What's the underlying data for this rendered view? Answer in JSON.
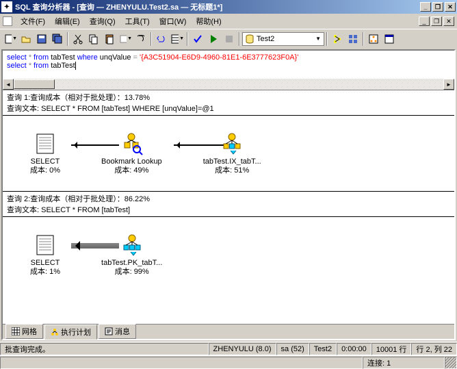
{
  "title": "SQL 查询分析器 - [查询 — ZHENYULU.Test2.sa — 无标题1*]",
  "menu": {
    "file": "文件(F)",
    "edit": "编辑(E)",
    "query": "查询(Q)",
    "tools": "工具(T)",
    "window": "窗口(W)",
    "help": "帮助(H)"
  },
  "toolbar": {
    "db_selected": "Test2"
  },
  "sql": {
    "line1_select": "select",
    "line1_star": "*",
    "line1_from": "from",
    "line1_tab": "tabTest",
    "line1_where": "where",
    "line1_col": "unqValue",
    "line1_eq": "=",
    "line1_str": "'{A3C51904-E6D9-4960-81E1-6E3777623F0A}'",
    "line2_select": "select",
    "line2_star": "*",
    "line2_from": "from",
    "line2_tab": "tabTest"
  },
  "plan": {
    "q1": {
      "header": "查询 1:查询成本（相对于批处理）：13.78%",
      "text": "查询文本: SELECT * FROM [tabTest] WHERE [unqValue]=@1",
      "nodes": [
        {
          "label": "SELECT",
          "cost": "成本: 0%"
        },
        {
          "label": "Bookmark Lookup",
          "cost": "成本: 49%"
        },
        {
          "label": "tabTest.IX_tabT...",
          "cost": "成本: 51%"
        }
      ]
    },
    "q2": {
      "header": "查询 2:查询成本（相对于批处理）：86.22%",
      "text": "查询文本: SELECT * FROM [tabTest]",
      "nodes": [
        {
          "label": "SELECT",
          "cost": "成本: 1%"
        },
        {
          "label": "tabTest.PK_tabT...",
          "cost": "成本: 99%"
        }
      ]
    }
  },
  "tabs": {
    "grid": "网格",
    "plan": "执行计划",
    "messages": "消息"
  },
  "status": {
    "msg": "批查询完成。",
    "server": "ZHENYULU (8.0)",
    "user": "sa (52)",
    "db": "Test2",
    "time": "0:00:00",
    "rows": "10001 行",
    "pos": "行 2, 列 22",
    "conn": "连接: 1"
  }
}
